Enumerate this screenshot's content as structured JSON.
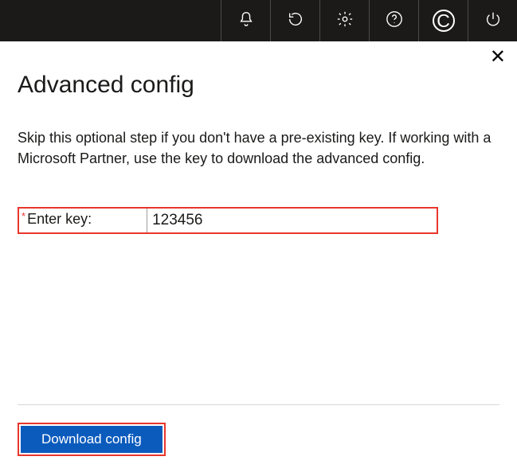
{
  "toolbar": {
    "icons": [
      "bell",
      "refresh",
      "settings",
      "help",
      "copyright",
      "power"
    ]
  },
  "panel": {
    "close_glyph": "✕",
    "title": "Advanced config",
    "description": "Skip this optional step if you don't have a pre-existing key. If working with a Microsoft Partner, use the key to download the advanced config.",
    "required_mark": "*",
    "key_label": "Enter key:",
    "key_value": "123456",
    "download_label": "Download config"
  }
}
